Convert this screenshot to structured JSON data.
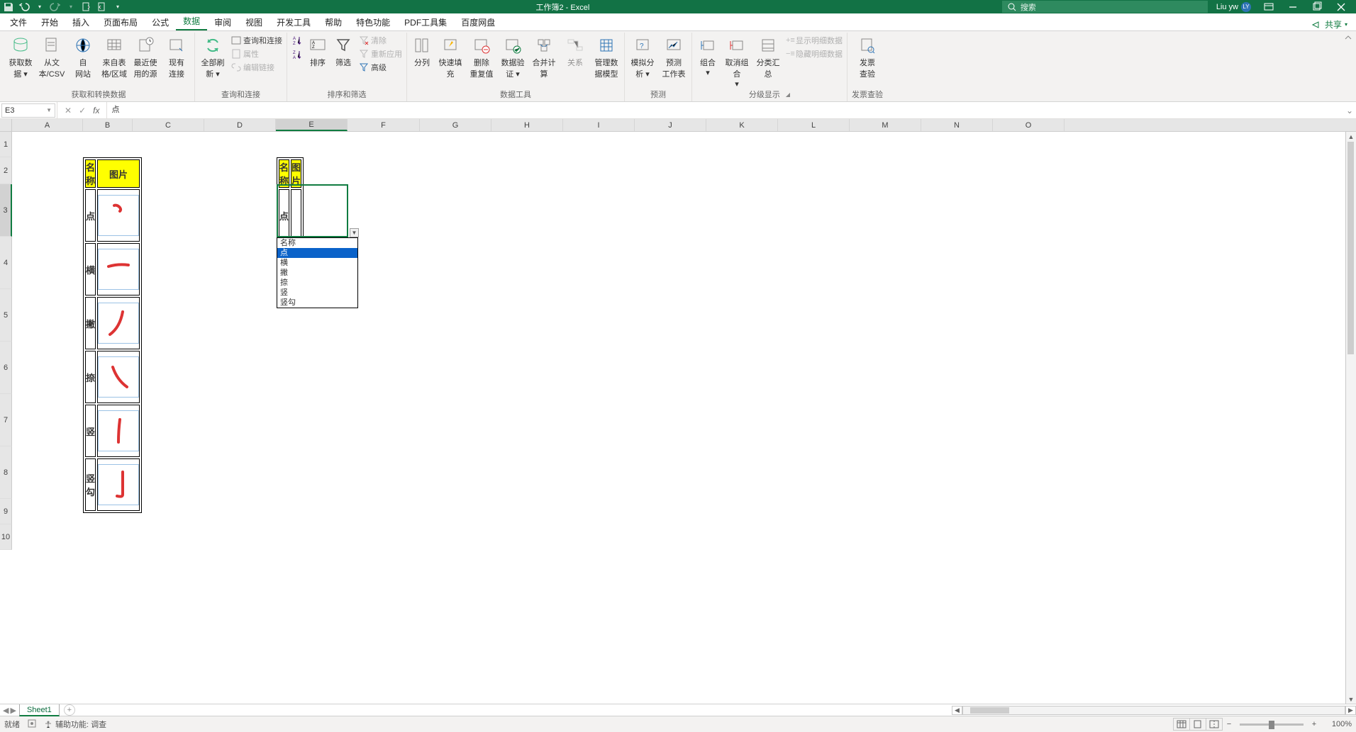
{
  "titlebar": {
    "title": "工作簿2 - Excel",
    "search_placeholder": "搜索",
    "user": "Liu yw",
    "avatar": "LY"
  },
  "tabs": [
    "文件",
    "开始",
    "插入",
    "页面布局",
    "公式",
    "数据",
    "审阅",
    "视图",
    "开发工具",
    "帮助",
    "特色功能",
    "PDF工具集",
    "百度网盘"
  ],
  "active_tab_index": 5,
  "share": "共享",
  "ribbon": {
    "group1": {
      "label": "获取和转换数据",
      "btns": [
        "获取数\n据 ▾",
        "从文\n本/CSV",
        "自\n网站",
        "来自表\n格/区域",
        "最近使\n用的源",
        "现有\n连接"
      ]
    },
    "group2": {
      "label": "查询和连接",
      "big": "全部刷\n新 ▾",
      "items": [
        "查询和连接",
        "属性",
        "编辑链接"
      ]
    },
    "group3": {
      "label": "排序和筛选",
      "btns": [
        "排序",
        "筛选"
      ],
      "items": [
        "清除",
        "重新应用",
        "高级"
      ]
    },
    "group4": {
      "label": "数据工具",
      "btns": [
        "分列",
        "快速填充",
        "删除\n重复值",
        "数据验\n证 ▾",
        "合并计算",
        "关系",
        "管理数\n据模型"
      ]
    },
    "group5": {
      "label": "预测",
      "btns": [
        "模拟分\n析 ▾",
        "预测\n工作表"
      ]
    },
    "group6": {
      "label": "分级显示",
      "btns": [
        "组合\n▾",
        "取消组合\n▾",
        "分类汇总"
      ],
      "items": [
        "显示明细数据",
        "隐藏明细数据"
      ]
    },
    "group7": {
      "label": "发票查验",
      "btns": [
        "发票\n查验"
      ]
    }
  },
  "namebox": "E3",
  "formula": "点",
  "columns": [
    "A",
    "B",
    "C",
    "D",
    "E",
    "F",
    "G",
    "H",
    "I",
    "J",
    "K",
    "L",
    "M",
    "N",
    "O"
  ],
  "rows": [
    "1",
    "2",
    "3",
    "4",
    "5",
    "6",
    "7",
    "8",
    "9",
    "10"
  ],
  "tableA": {
    "headers": [
      "名称",
      "图片"
    ],
    "rows": [
      {
        "name": "点",
        "stroke": "dian"
      },
      {
        "name": "横",
        "stroke": "heng"
      },
      {
        "name": "撇",
        "stroke": "pie"
      },
      {
        "name": "捺",
        "stroke": "na"
      },
      {
        "name": "竖",
        "stroke": "shu"
      },
      {
        "name": "竖勾",
        "stroke": "shugou"
      }
    ]
  },
  "tableB": {
    "headers": [
      "名称",
      "图片"
    ],
    "cell_value": "点"
  },
  "dv_options": [
    "名称",
    "点",
    "横",
    "撇",
    "捺",
    "竖",
    "竖勾"
  ],
  "dv_highlight_index": 1,
  "sheettab": "Sheet1",
  "statusbar": {
    "ready": "就绪",
    "acc": "辅助功能: 调查",
    "zoom": "100%"
  }
}
